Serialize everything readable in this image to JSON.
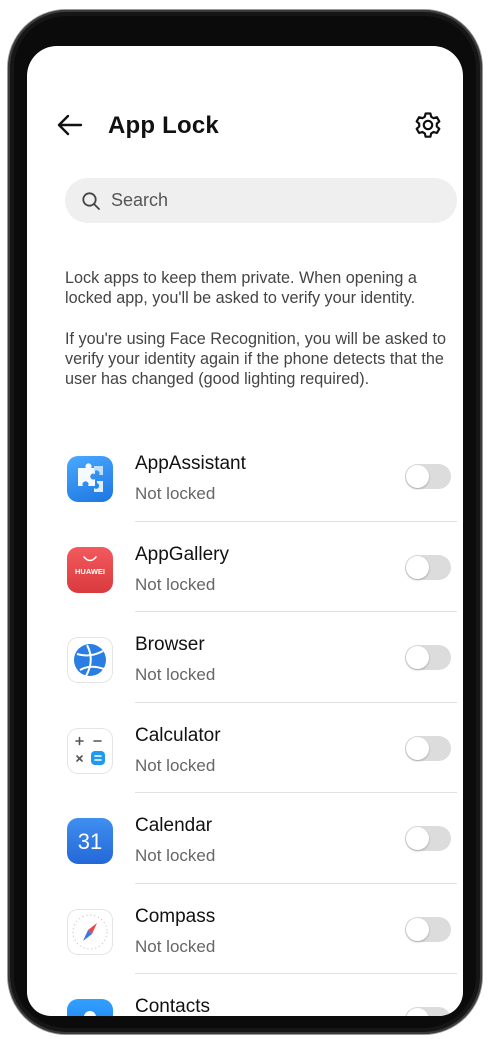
{
  "header": {
    "title": "App Lock"
  },
  "search": {
    "placeholder": "Search"
  },
  "description": {
    "paragraph1": "Lock apps to keep them private. When opening a locked app, you'll be asked to verify your identity.",
    "paragraph2": "If you're using Face Recognition, you will be asked to verify your identity again if the phone detects that the user has changed (good lighting required)."
  },
  "apps": [
    {
      "name": "AppAssistant",
      "status": "Not locked",
      "locked": false,
      "icon": "puzzle-icon",
      "color": "#2f8ff0"
    },
    {
      "name": "AppGallery",
      "status": "Not locked",
      "locked": false,
      "icon": "huawei-bag-icon",
      "icon_text": "HUAWEI",
      "color": "#e8484b"
    },
    {
      "name": "Browser",
      "status": "Not locked",
      "locked": false,
      "icon": "globe-icon",
      "color": "#2a7de1"
    },
    {
      "name": "Calculator",
      "status": "Not locked",
      "locked": false,
      "icon": "calculator-icon",
      "color": "#1e9bf0"
    },
    {
      "name": "Calendar",
      "status": "Not locked",
      "locked": false,
      "icon": "calendar-icon",
      "icon_text": "31",
      "color": "#2f7fe8"
    },
    {
      "name": "Compass",
      "status": "Not locked",
      "locked": false,
      "icon": "compass-icon",
      "color": "#3a76e6"
    },
    {
      "name": "Contacts",
      "status": "",
      "locked": false,
      "icon": "contacts-icon",
      "color": "#1e88f0"
    }
  ],
  "colors": {
    "background": "#ffffff",
    "search_bg": "#efefef",
    "toggle_off": "#dcdcdc",
    "divider": "#e1e1e1"
  }
}
